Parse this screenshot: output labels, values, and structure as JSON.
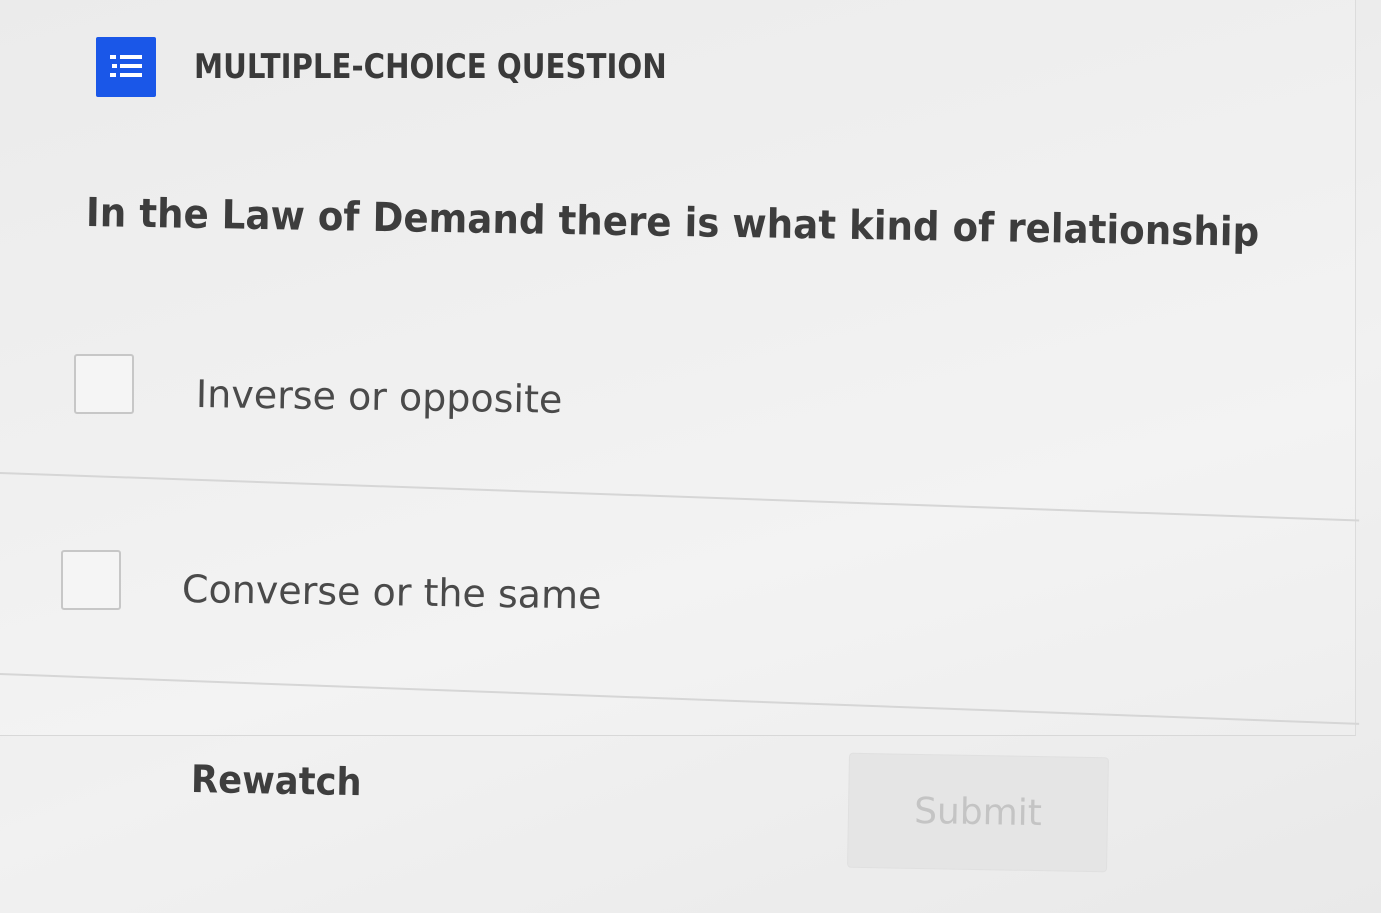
{
  "header": {
    "icon": "numbered-list-icon",
    "title": "MULTIPLE-CHOICE QUESTION"
  },
  "question": {
    "text": "In the Law of Demand there is what kind of relationship"
  },
  "options": [
    {
      "label": "Inverse or opposite",
      "checked": false
    },
    {
      "label": "Converse or the same",
      "checked": false
    }
  ],
  "actions": {
    "rewatch_label": "Rewatch",
    "submit_label": "Submit",
    "submit_disabled": true
  },
  "colors": {
    "accent": "#1a57e8",
    "background": "#ececec"
  }
}
